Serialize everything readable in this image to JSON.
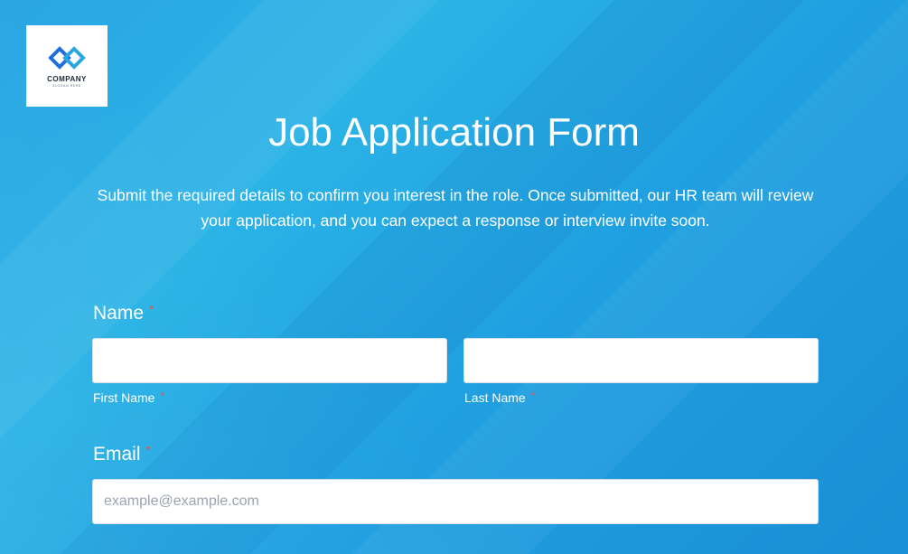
{
  "logo": {
    "name": "COMPANY",
    "slogan": "SLOGAN HERE",
    "colors": {
      "primary": "#1e6fd9",
      "secondary": "#2aa6e3"
    }
  },
  "form": {
    "title": "Job Application Form",
    "description": "Submit the required details to confirm you interest in the role. Once submitted, our HR team will review your application, and you can expect a response or interview invite soon.",
    "required_marker": "*",
    "name_field": {
      "label": "Name",
      "first_name": {
        "value": "",
        "sublabel": "First Name"
      },
      "last_name": {
        "value": "",
        "sublabel": "Last Name"
      }
    },
    "email_field": {
      "label": "Email",
      "value": "",
      "placeholder": "example@example.com"
    }
  },
  "colors": {
    "background": "#2aa6e3",
    "required": "#e55353",
    "text": "#ffffff",
    "input_bg": "#ffffff"
  }
}
